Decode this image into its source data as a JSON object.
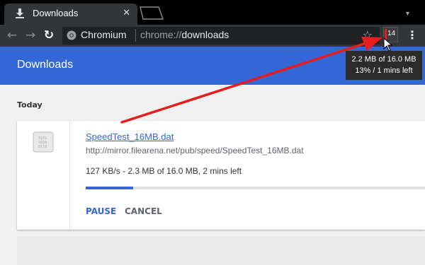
{
  "tab": {
    "title": "Downloads",
    "close_icon": "close-icon",
    "icon": "download-icon"
  },
  "toolbar": {
    "back_icon": "arrow-left-icon",
    "forward_icon": "arrow-right-icon",
    "reload_icon": "reload-icon",
    "star_icon": "star-icon",
    "menu_icon": "three-dots-icon"
  },
  "omnibox": {
    "origin_label": "Chromium",
    "url_scheme": "chrome://",
    "url_host": "downloads"
  },
  "extension": {
    "badge_count": "14",
    "tooltip_line1": "2.2 MB of 16.0 MB",
    "tooltip_line2": "13% / 1 mins left"
  },
  "page": {
    "title": "Downloads",
    "section_date": "Today"
  },
  "download": {
    "filename": "SpeedTest_16MB.dat",
    "url": "http://mirror.filearena.net/pub/speed/SpeedTest_16MB.dat",
    "status": "127 KB/s - 2.3 MB of 16.0 MB, 2 mins left",
    "progress_fraction": 0.14,
    "pause_label": "PAUSE",
    "cancel_label": "CANCEL"
  },
  "colors": {
    "accent": "#3367d6",
    "annotation_arrow": "#e81c1c",
    "toolbar": "#333639"
  }
}
